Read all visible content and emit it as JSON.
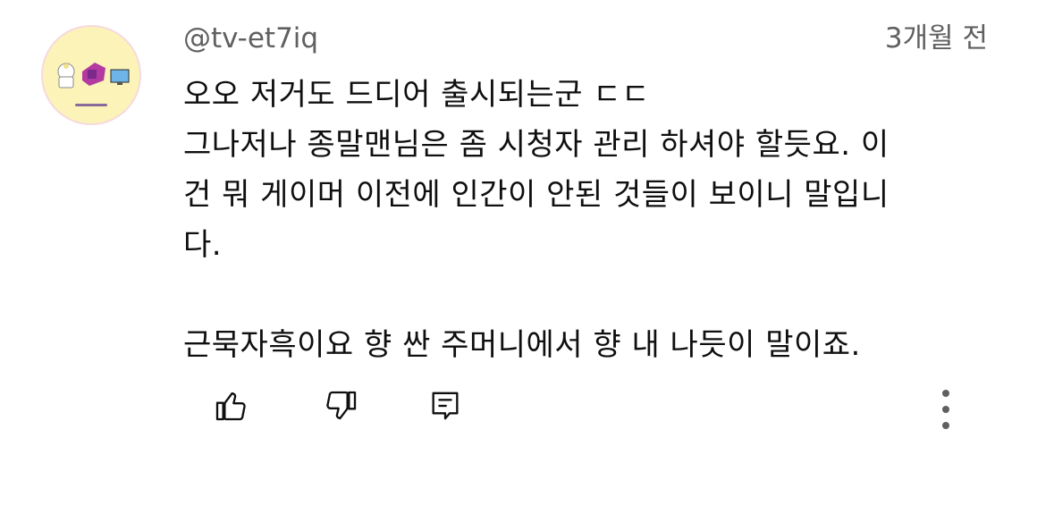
{
  "comment": {
    "author": "@tv-et7iq",
    "timestamp": "3개월 전",
    "lines": [
      "오오 저거도 드디어 출시되는군 ㄷㄷ",
      "그나저나 종말맨님은 좀 시청자 관리 하셔야 할듯요. 이",
      "건 뭐 게이머 이전에 인간이 안된 것들이 보이니 말입니",
      "다.",
      "근묵자흑이요 향 싼 주머니에서 향 내 나듯이 말이죠."
    ]
  },
  "actions": {
    "like_icon": "thumb-up-icon",
    "dislike_icon": "thumb-down-icon",
    "reply_icon": "comment-reply-icon",
    "more_icon": "more-vert-icon"
  },
  "colors": {
    "meta_text": "#606060",
    "body_text": "#0f0f0f",
    "icon": "#0f0f0f",
    "background": "#ffffff",
    "avatar_bg": "#fbf3b8"
  }
}
